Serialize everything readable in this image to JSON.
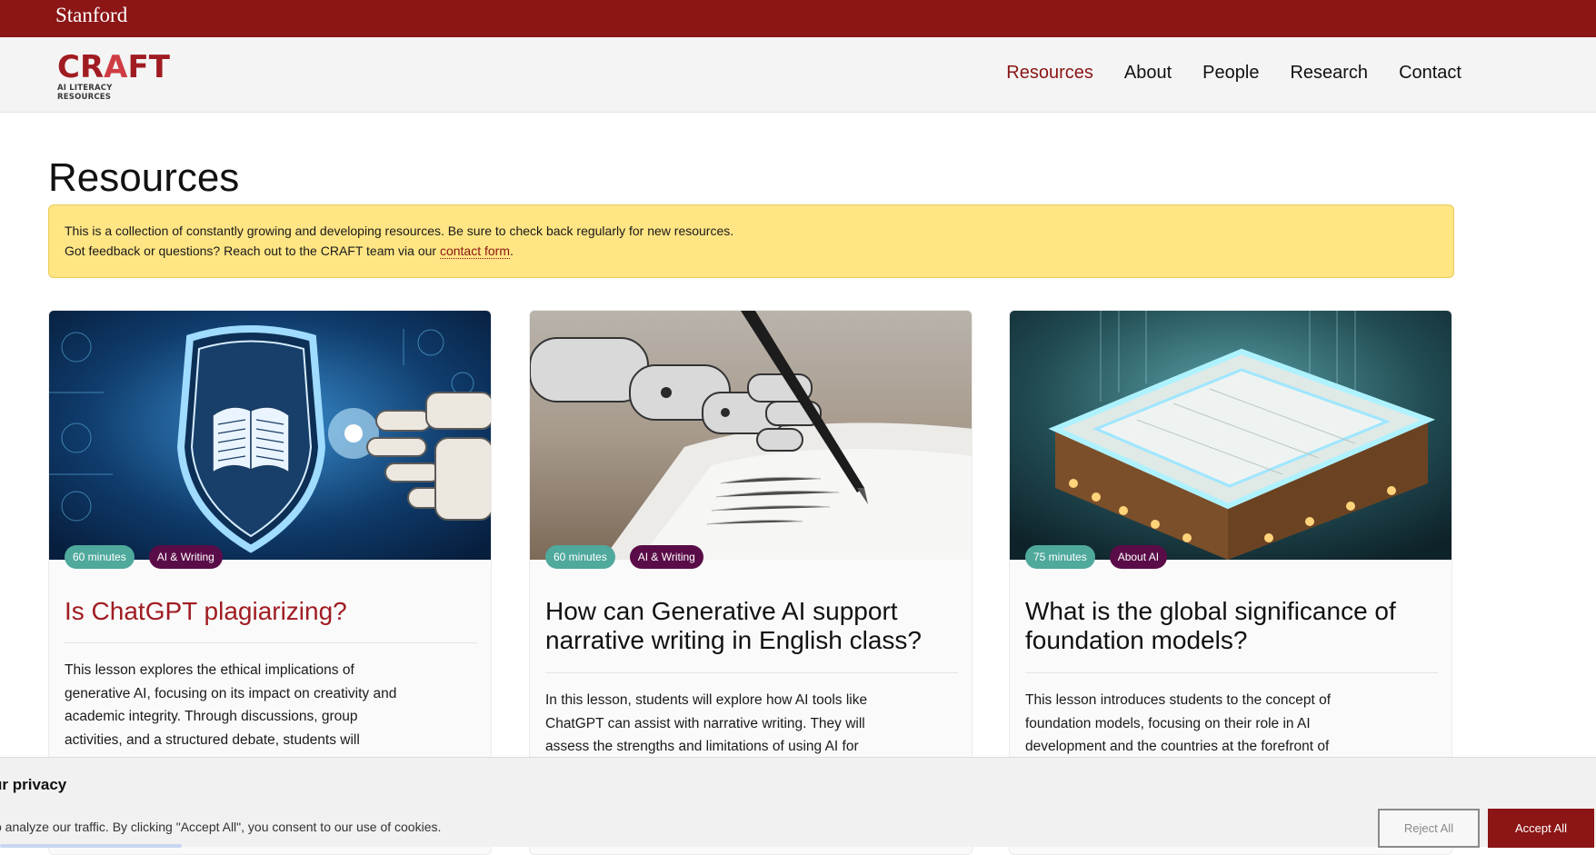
{
  "stanford_bar": {
    "wordmark": "Stanford"
  },
  "logo": {
    "title": "CRAFT",
    "tagline": "AI LITERACY RESOURCES"
  },
  "nav": {
    "items": [
      {
        "label": "Resources",
        "active": true
      },
      {
        "label": "About",
        "active": false
      },
      {
        "label": "People",
        "active": false
      },
      {
        "label": "Research",
        "active": false
      },
      {
        "label": "Contact",
        "active": false
      }
    ]
  },
  "page": {
    "title": "Resources"
  },
  "notice": {
    "line1": "This is a collection of constantly growing and developing resources. Be sure to check back regularly for new resources.",
    "line2_prefix": "Got feedback or questions? Reach out to the CRAFT team via our ",
    "link": "contact form",
    "line2_suffix": "."
  },
  "cards": [
    {
      "duration": "60 minutes",
      "topic": "AI & Writing",
      "title": "Is ChatGPT plagiarizing?",
      "description": "This lesson explores the ethical implications of generative AI, focusing on its impact on creativity and academic integrity. Through discussions, group activities, and a structured debate, students will"
    },
    {
      "duration": "60 minutes",
      "topic": "AI & Writing",
      "title": "How can Generative AI support narrative writing in English class?",
      "description": "In this lesson, students will explore how AI tools like ChatGPT can assist with narrative writing. They will assess the strengths and limitations of using AI for"
    },
    {
      "duration": "75 minutes",
      "topic": "About AI",
      "title": "What is the global significance of foundation models?",
      "description": "This lesson introduces students to the concept of foundation models, focusing on their role in AI development and the countries at the forefront of"
    }
  ],
  "cookie": {
    "title": "ur privacy",
    "text": "o analyze our traffic. By clicking \"Accept All\", you consent to our use of cookies.",
    "reject_label": "Reject All",
    "accept_label": "Accept All"
  },
  "colors": {
    "stanford_red": "#8c1515",
    "notice_yellow": "#ffe584",
    "badge_teal": "#4fa99c",
    "badge_purple": "#5a0c48"
  }
}
